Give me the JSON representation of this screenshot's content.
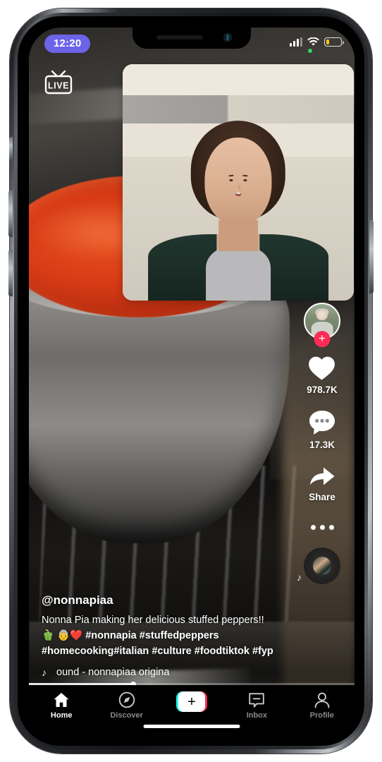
{
  "status_bar": {
    "time": "12:20",
    "signal_icon": "cellular-signal-icon",
    "wifi_icon": "wifi-icon",
    "battery_icon": "battery-low-icon",
    "battery_level_pct": 22,
    "time_pill_color": "#6c63e8",
    "battery_color": "#f5c518"
  },
  "overlay": {
    "live_badge_label": "LIVE",
    "live_badge_icon": "live-tv-icon"
  },
  "rail": {
    "avatar_name": "creator-avatar",
    "follow_label": "+",
    "follow_color": "#fe2c55",
    "like": {
      "icon": "heart-icon",
      "count": "978.7K"
    },
    "comment": {
      "icon": "comment-bubble-icon",
      "count": "17.3K"
    },
    "share": {
      "icon": "share-arrow-icon",
      "label": "Share"
    },
    "more": {
      "icon": "more-dots-icon"
    },
    "music_disc": {
      "icon": "music-disc-icon",
      "note_icon": "music-note-icon"
    }
  },
  "caption": {
    "handle": "@nonnapiaa",
    "text_plain": "Nonna Pia making her delicious stuffed peppers!! ",
    "emojis": "🫑 👵❤️",
    "hashtags": [
      "#nonnapia",
      "#stuffedpeppers",
      "#homecooking",
      "#italian",
      "#culture",
      "#foodtiktok",
      "#fyp"
    ],
    "music_note_icon": "music-note-icon",
    "music_ticker": "ound - nonnapiaa     origina"
  },
  "progress": {
    "percent": 32
  },
  "nav": {
    "items": [
      {
        "label": "Home",
        "icon": "home-icon",
        "active": true
      },
      {
        "label": "Discover",
        "icon": "compass-icon",
        "active": false
      },
      {
        "label": "Inbox",
        "icon": "inbox-icon",
        "active": false
      },
      {
        "label": "Profile",
        "icon": "person-icon",
        "active": false
      }
    ],
    "create_label": "+",
    "create_colors": {
      "cyan": "#25f4ee",
      "red": "#fe2c55"
    }
  }
}
